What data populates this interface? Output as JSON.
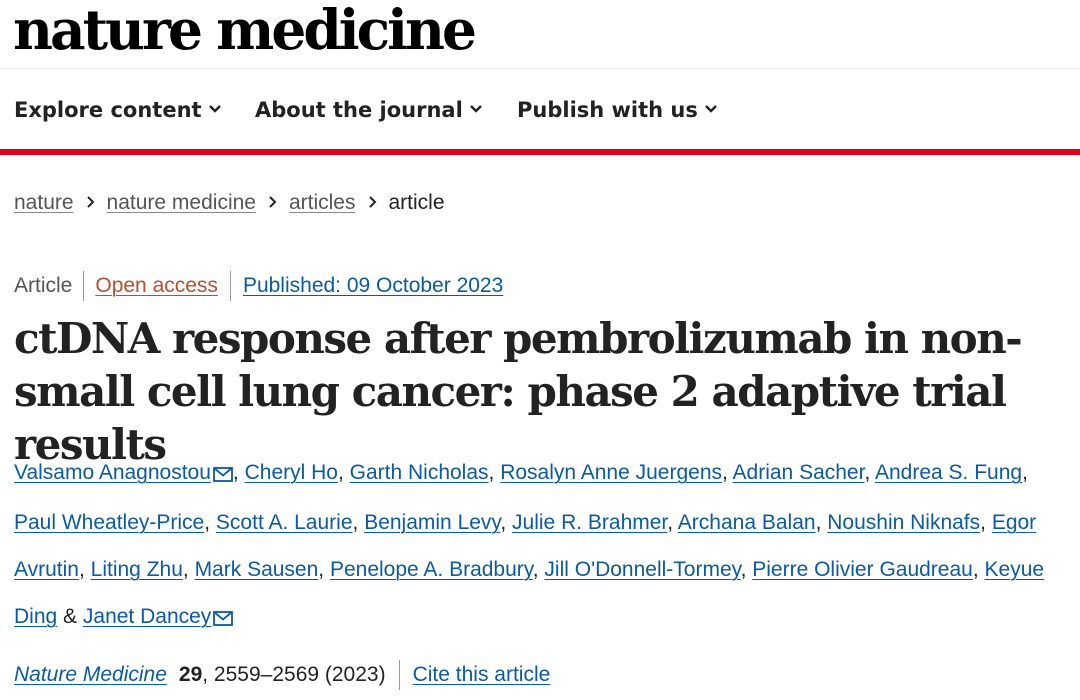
{
  "header": {
    "logo": "nature medicine"
  },
  "nav": {
    "items": [
      {
        "label": "Explore content"
      },
      {
        "label": "About the journal"
      },
      {
        "label": "Publish with us"
      }
    ]
  },
  "breadcrumb": {
    "items": [
      "nature",
      "nature medicine",
      "articles"
    ],
    "current": "article"
  },
  "article": {
    "type": "Article",
    "access": "Open access",
    "published": "Published: 09 October 2023",
    "title": "ctDNA response after pembrolizumab in non-small cell lung cancer: phase 2 adaptive trial results",
    "authors": [
      "Valsamo Anagnostou",
      "Cheryl Ho",
      "Garth Nicholas",
      "Rosalyn Anne Juergens",
      "Adrian Sacher",
      "Andrea S. Fung",
      "Paul Wheatley-Price",
      "Scott A. Laurie",
      "Benjamin Levy",
      "Julie R. Brahmer",
      "Archana Balan",
      "Noushin Niknafs",
      "Egor Avrutin",
      "Liting Zhu",
      "Mark Sausen",
      "Penelope A. Bradbury",
      "Jill O'Donnell-Tormey",
      "Pierre Olivier Gaudreau",
      "Keyue Ding",
      "Janet Dancey"
    ],
    "author_separator": ", ",
    "author_final_separator": " & ",
    "citation": {
      "journal": "Nature Medicine",
      "volume": "29",
      "pages": ", 2559–2569 (2023)",
      "cite_link": "Cite this article"
    }
  },
  "colors": {
    "accent_red": "#e2001a",
    "link_blue": "#0b5aa6",
    "open_access": "#b94e2c"
  },
  "icons": {
    "nav_dropdown": "chevron-down-icon",
    "breadcrumb_separator": "chevron-right-icon",
    "corresponding_author": "envelope-icon"
  }
}
